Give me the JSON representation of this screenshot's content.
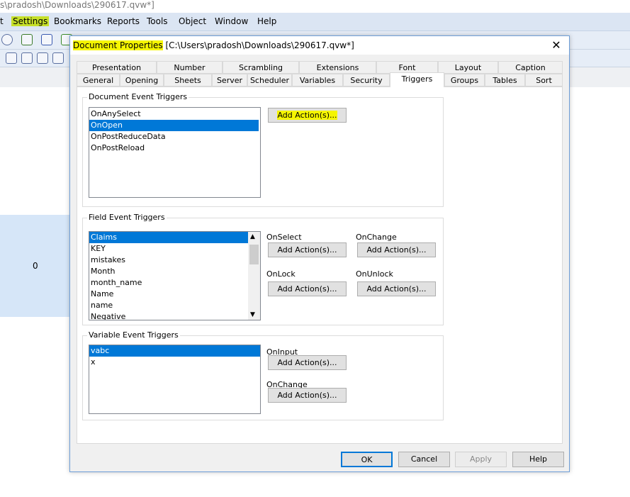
{
  "app": {
    "title": "s\\pradosh\\Downloads\\290617.qvw*]",
    "menu": [
      "t",
      "Settings",
      "Bookmarks",
      "Reports",
      "Tools",
      "Object",
      "Window",
      "Help"
    ],
    "highlight_color": "#c6e02a",
    "cell_value": "0"
  },
  "dialog": {
    "title_highlighted": "Document Properties",
    "title_rest": " [C:\\Users\\pradosh\\Downloads\\290617.qvw*]",
    "close": "✕",
    "tabs_row1": [
      "Presentation",
      "Number",
      "Scrambling",
      "Extensions",
      "Font",
      "Layout",
      "Caption"
    ],
    "tabs_row2": [
      "General",
      "Opening",
      "Sheets",
      "Server",
      "Scheduler",
      "Variables",
      "Security",
      "Triggers",
      "Groups",
      "Tables",
      "Sort"
    ],
    "active_tab": "Triggers",
    "document_group": {
      "label": "Document Event Triggers",
      "items": [
        "OnAnySelect",
        "OnOpen",
        "OnPostReduceData",
        "OnPostReload"
      ],
      "selected": "OnOpen",
      "button": "Add Action(s)..."
    },
    "field_group": {
      "label": "Field Event Triggers",
      "items": [
        "Claims",
        "KEY",
        "mistakes",
        "Month",
        "month_name",
        "Name",
        "name",
        "Negative"
      ],
      "selected": "Claims",
      "on_select": "OnSelect",
      "on_change": "OnChange",
      "on_lock": "OnLock",
      "on_unlock": "OnUnlock",
      "button": "Add Action(s)..."
    },
    "variable_group": {
      "label": "Variable Event Triggers",
      "items": [
        "vabc",
        "x"
      ],
      "selected": "vabc",
      "on_input": "OnInput",
      "on_change": "OnChange",
      "button": "Add Action(s)..."
    },
    "buttons": {
      "ok": "OK",
      "cancel": "Cancel",
      "apply": "Apply",
      "help": "Help"
    }
  }
}
